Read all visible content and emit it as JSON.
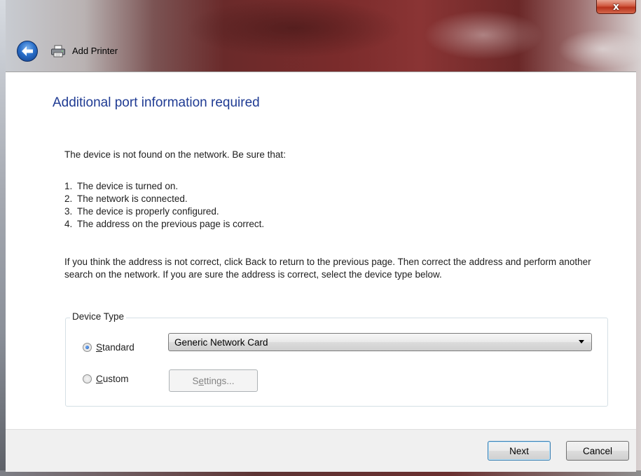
{
  "window": {
    "title": "Add Printer",
    "close_glyph": "x"
  },
  "page": {
    "heading": "Additional port information required",
    "intro": "The device is not found on the network.  Be sure that:",
    "checklist": [
      {
        "num": "1.",
        "text": "The device is turned on."
      },
      {
        "num": "2.",
        "text": "The network is connected."
      },
      {
        "num": "3.",
        "text": "The device is properly configured."
      },
      {
        "num": "4.",
        "text": "The address on the previous page is correct."
      }
    ],
    "paragraph": "If you think the address is not correct, click Back to return to the previous page.  Then correct the address and perform another search on the network.  If you are sure the address is correct, select the device type below."
  },
  "device_type": {
    "legend": "Device Type",
    "standard": {
      "label_prefix": "",
      "accel": "S",
      "label_rest": "tandard",
      "selected": true
    },
    "custom": {
      "accel": "C",
      "label_rest": "ustom",
      "selected": false
    },
    "dropdown_value": "Generic Network Card",
    "settings": {
      "pre": "S",
      "accel": "e",
      "rest": "ttings...",
      "enabled": false
    }
  },
  "footer": {
    "next_label": "Next",
    "cancel_label": "Cancel"
  },
  "icons": {
    "back": "back-arrow-icon",
    "printer": "printer-icon",
    "close": "close-icon",
    "dropdown": "chevron-down-icon"
  },
  "colors": {
    "heading": "#1f3b93",
    "close_button": "#c8432a",
    "back_button": "#2a6fc9"
  }
}
